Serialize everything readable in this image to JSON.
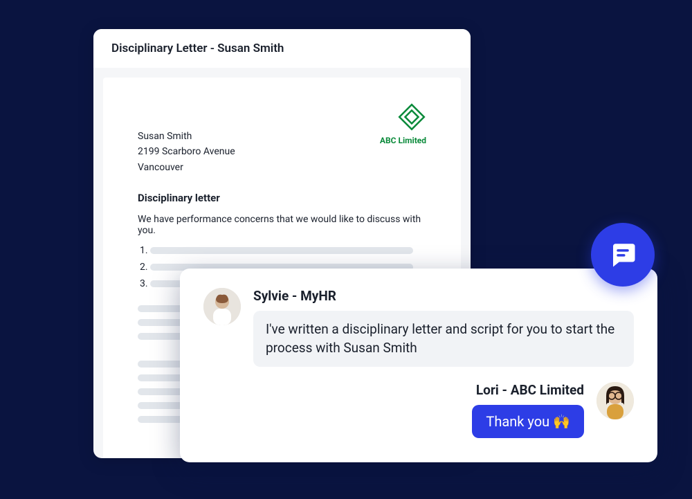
{
  "document": {
    "window_title": "Disciplinary Letter - Susan Smith",
    "company_name": "ABC Limited",
    "recipient_name": "Susan Smith",
    "recipient_street": "2199 Scarboro Avenue",
    "recipient_city": "Vancouver",
    "heading": "Disciplinary letter",
    "intro_line": "We have performance concerns that we would like to discuss with you.",
    "list_items": [
      "1.",
      "2.",
      "3."
    ]
  },
  "chat": {
    "messages": [
      {
        "sender": "Sylvie - MyHR",
        "text": "I've written a disciplinary letter and script for you to start the process with Susan Smith",
        "side": "left"
      },
      {
        "sender": "Lori - ABC Limited",
        "text": "Thank you 🙌",
        "side": "right"
      }
    ]
  },
  "colors": {
    "brand_green": "#0a8a3a",
    "brand_blue": "#2d3de6"
  }
}
